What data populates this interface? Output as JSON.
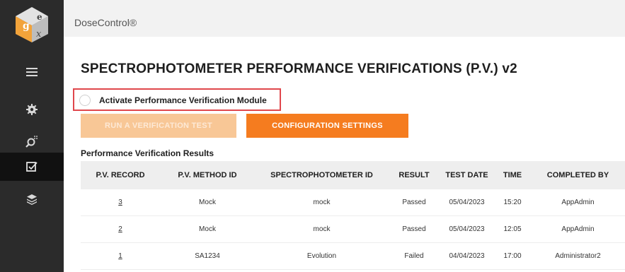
{
  "app": {
    "name": "DoseControl®"
  },
  "sidebar": {
    "items": [
      {
        "icon": "menu-icon",
        "active": false
      },
      {
        "icon": "gear-icon",
        "active": false
      },
      {
        "icon": "search-icon",
        "active": false
      },
      {
        "icon": "checkbox-icon",
        "active": true
      },
      {
        "icon": "layers-icon",
        "active": false
      }
    ]
  },
  "page": {
    "title": "SPECTROPHOTOMETER PERFORMANCE VERIFICATIONS (P.V.) v2",
    "module_toggle": {
      "label": "Activate Performance Verification Module",
      "on": false
    },
    "buttons": {
      "run_label": "RUN A VERIFICATION TEST",
      "config_label": "CONFIGURATION SETTINGS"
    },
    "results_heading": "Performance Verification Results"
  },
  "table": {
    "columns": [
      "P.V. RECORD",
      "P.V. METHOD ID",
      "SPECTROPHOTOMETER ID",
      "RESULT",
      "TEST DATE",
      "TIME",
      "COMPLETED BY"
    ],
    "rows": [
      {
        "record": "3",
        "method_id": "Mock",
        "spectro_id": "mock",
        "result": "Passed",
        "test_date": "05/04/2023",
        "time": "15:20",
        "completed_by": "AppAdmin"
      },
      {
        "record": "2",
        "method_id": "Mock",
        "spectro_id": "mock",
        "result": "Passed",
        "test_date": "05/04/2023",
        "time": "12:05",
        "completed_by": "AppAdmin"
      },
      {
        "record": "1",
        "method_id": "SA1234",
        "spectro_id": "Evolution",
        "result": "Failed",
        "test_date": "04/04/2023",
        "time": "17:00",
        "completed_by": "Administrator2"
      }
    ]
  },
  "colors": {
    "sidebar_bg": "#2b2b2b",
    "accent_orange": "#f57c1f",
    "disabled_orange": "#f8c796",
    "highlight_red": "#e0474c",
    "passed_green": "#63b94a",
    "failed_red": "#e04a4a"
  }
}
